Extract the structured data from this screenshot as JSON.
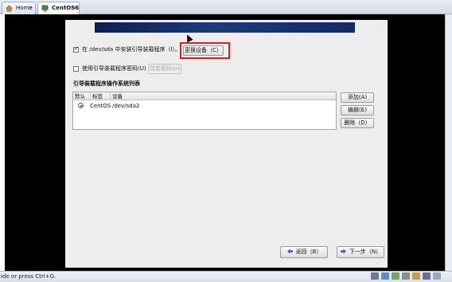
{
  "tabs": [
    {
      "label": "Home",
      "close": "×"
    },
    {
      "label": "CentOS6",
      "close": "×"
    }
  ],
  "installer": {
    "install_bootloader_label": "在 /dev/sda 中安装引导装载程序（I）。",
    "install_bootloader_checked": true,
    "change_device_button": "更换设备（C）",
    "use_password_label": "使用引导装载程序密码(U)",
    "use_password_checked": false,
    "change_password_button": "改变密码(p)",
    "os_list_title": "引导装载程序操作系统列表",
    "table": {
      "headers": [
        "默认",
        "标签",
        "设备"
      ],
      "rows": [
        {
          "default": true,
          "label": "CentOS",
          "device": "/dev/sda2"
        }
      ]
    },
    "side_buttons": {
      "add": "添加(A)",
      "edit": "编辑(E)",
      "delete": "删除（D）"
    },
    "nav": {
      "back": "返回（B）",
      "next": "下一步（N）"
    }
  },
  "statusbar": {
    "text": "ide or press Ctrl+G."
  },
  "colors": {
    "highlight_box": "#d62020",
    "banner": "#1e3a7c",
    "vm_background": "#000000"
  },
  "icons": [
    "home-icon",
    "vm-icon",
    "back-arrow-icon",
    "next-arrow-icon"
  ]
}
